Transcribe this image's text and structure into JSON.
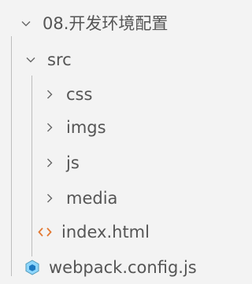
{
  "explorer": {
    "root": {
      "label": "08.开发环境配置",
      "icon": "chevron-down-icon"
    },
    "src": {
      "label": "src",
      "icon": "chevron-down-icon"
    },
    "folders": [
      {
        "label": "css",
        "icon": "chevron-right-icon"
      },
      {
        "label": "imgs",
        "icon": "chevron-right-icon"
      },
      {
        "label": "js",
        "icon": "chevron-right-icon"
      },
      {
        "label": "media",
        "icon": "chevron-right-icon"
      }
    ],
    "html_file": {
      "label": "index.html",
      "icon": "html-file-icon"
    },
    "config_file": {
      "label": "webpack.config.js",
      "icon": "webpack-icon"
    }
  },
  "colors": {
    "background": "#f3f3f3",
    "text": "#555555",
    "guide_line": "#bdbdbd",
    "html_icon": "#e37933",
    "webpack_icon": "#519aba"
  }
}
